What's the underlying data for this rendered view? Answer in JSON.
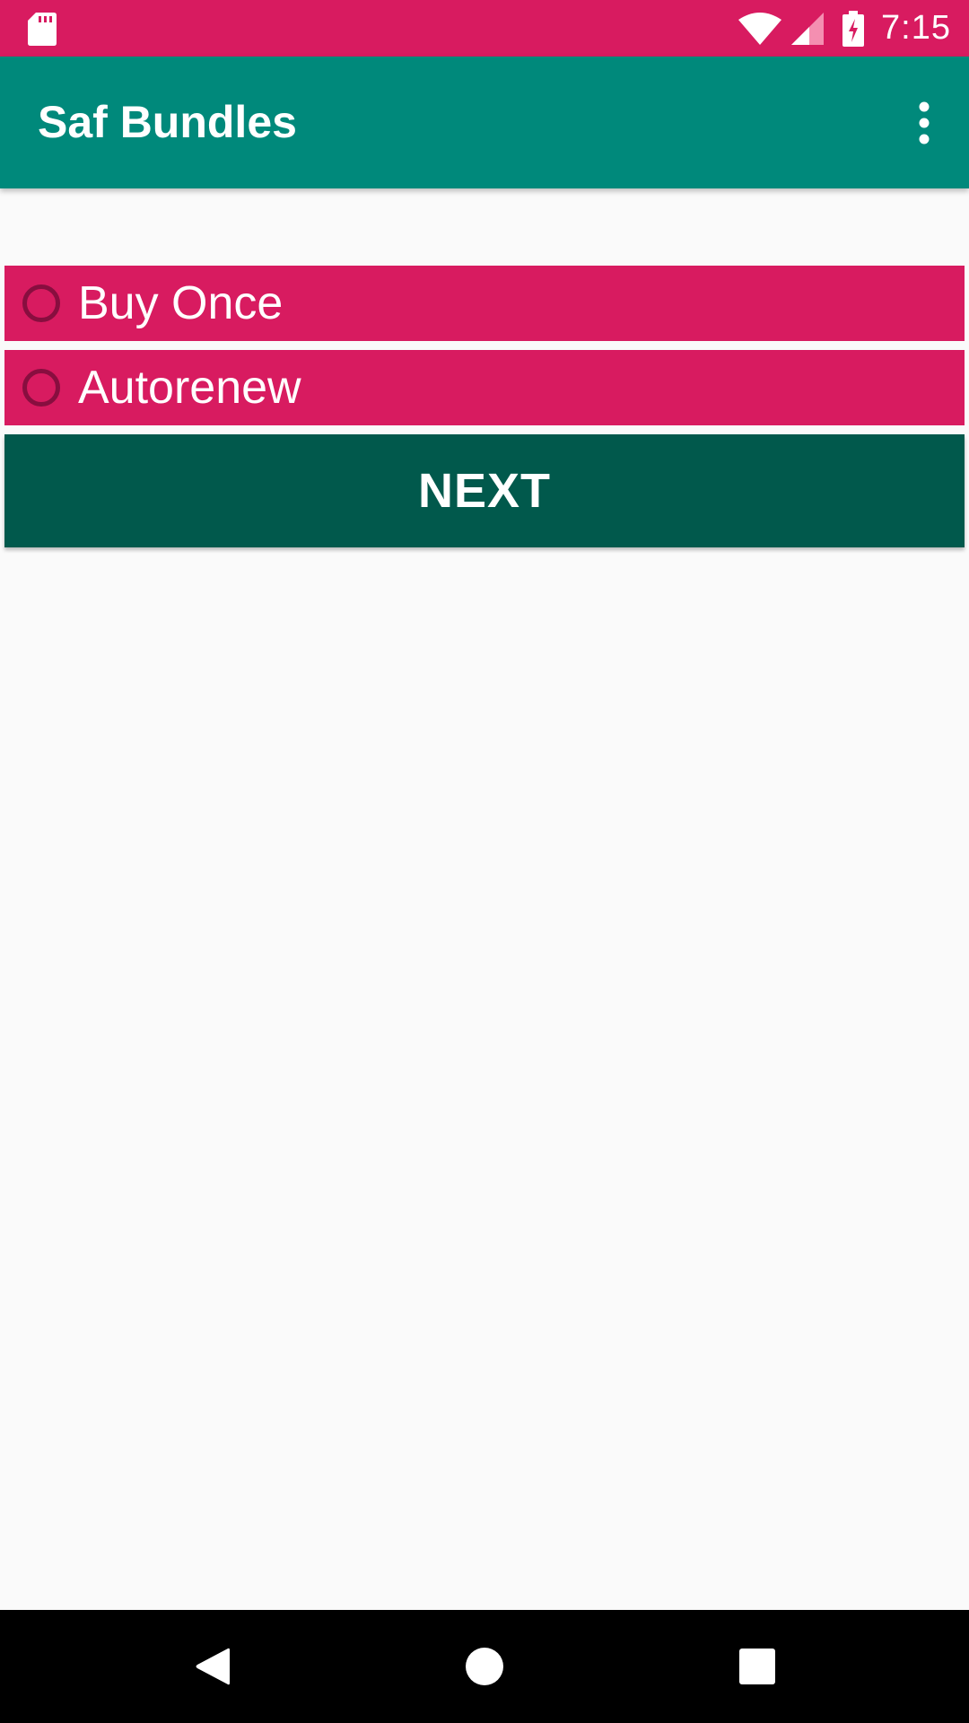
{
  "status_bar": {
    "time": "7:15",
    "icons": [
      "sd-card-icon",
      "wifi-icon",
      "signal-icon",
      "battery-charging-icon"
    ],
    "background": "#d81b60"
  },
  "app_bar": {
    "title": "Saf Bundles",
    "background": "#00897b",
    "overflow_icon": "more-vert-icon"
  },
  "options": [
    {
      "label": "Buy Once",
      "selected": false
    },
    {
      "label": "Autorenew",
      "selected": false
    }
  ],
  "next_button": {
    "label": "NEXT",
    "background": "#01594c"
  },
  "colors": {
    "accent": "#d81b60",
    "primary": "#00897b",
    "primary_dark": "#01594c",
    "page_background": "#fafafa"
  },
  "nav_bar": {
    "icons": [
      "back-icon",
      "home-icon",
      "recents-icon"
    ]
  }
}
